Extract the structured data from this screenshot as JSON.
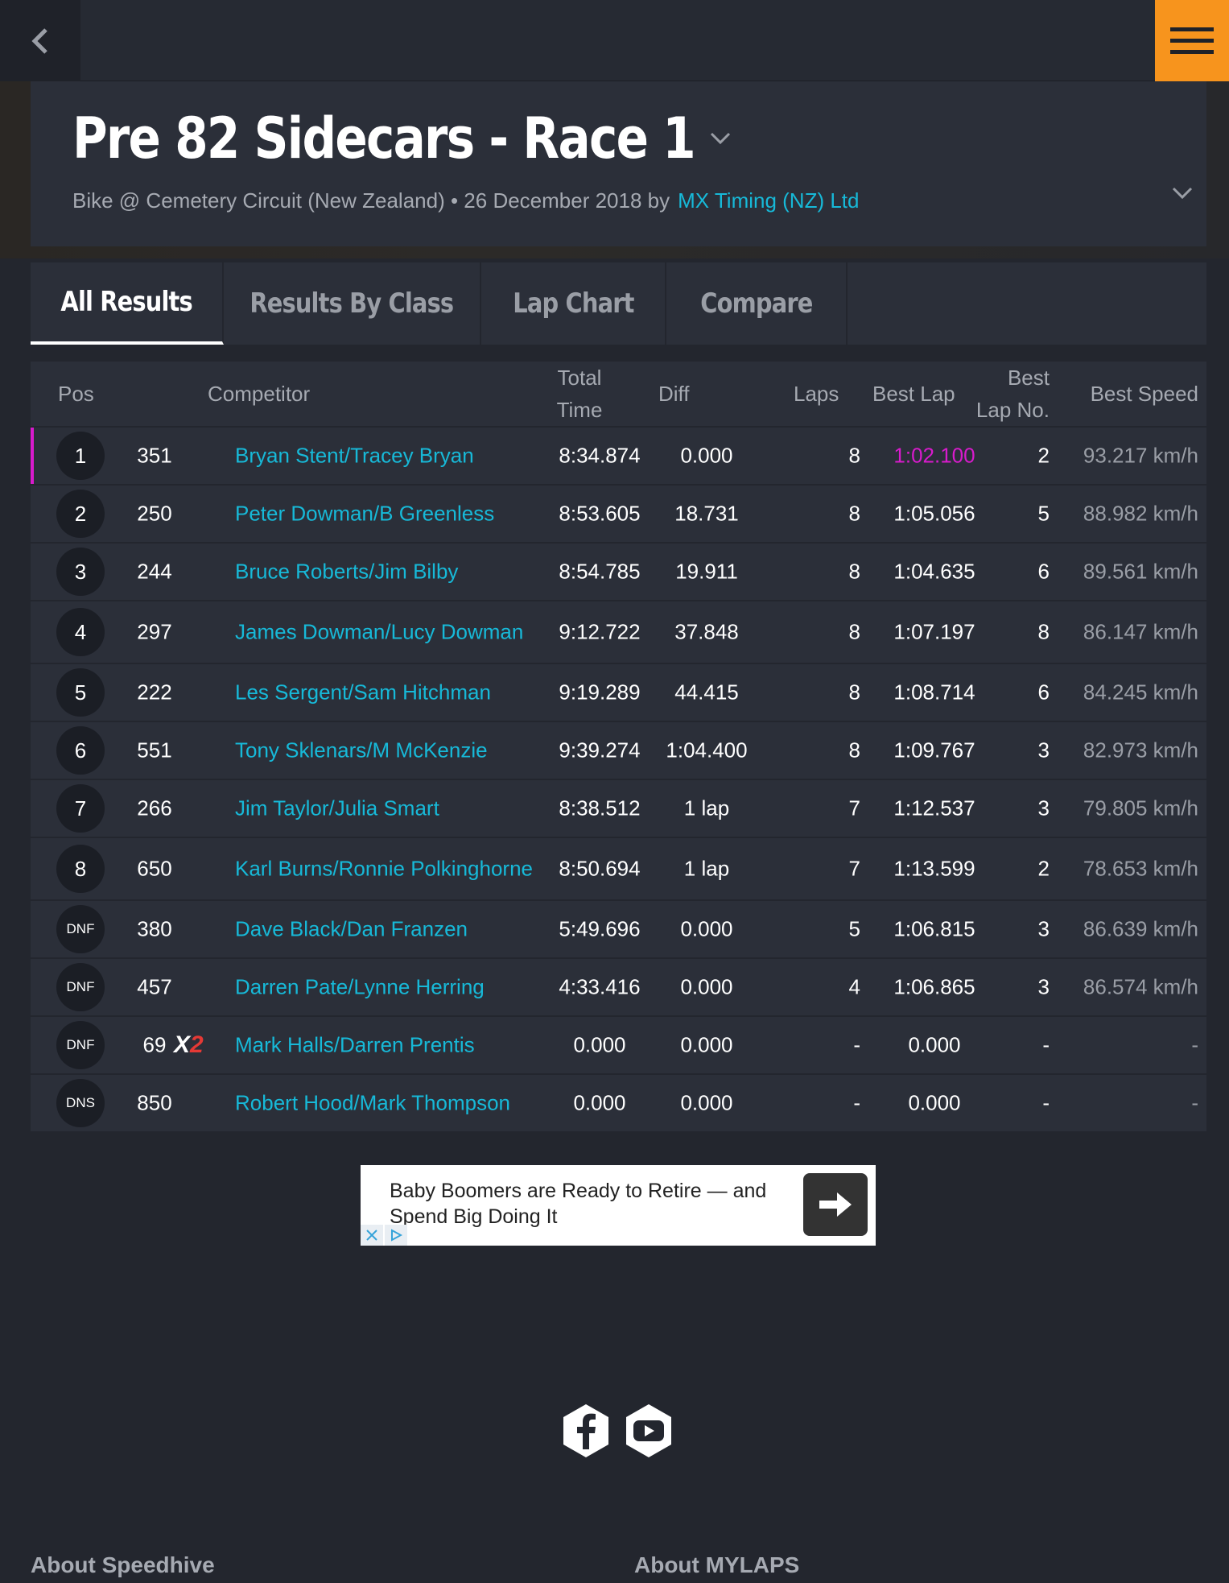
{
  "race": {
    "title": "Pre 82 Sidecars - Race 1",
    "subtitle": "Bike @ Cemetery Circuit (New Zealand) • 26 December 2018 by",
    "organizer": "MX Timing (NZ) Ltd"
  },
  "tabs": [
    {
      "label": "All Results"
    },
    {
      "label": "Results By Class"
    },
    {
      "label": "Lap Chart"
    },
    {
      "label": "Compare"
    }
  ],
  "columns": {
    "pos": "Pos",
    "competitor": "Competitor",
    "total_time_1": "Total",
    "total_time_2": "Time",
    "diff": "Diff",
    "laps": "Laps",
    "best_lap": "Best Lap",
    "best_lap_no_1": "Best",
    "best_lap_no_2": "Lap No.",
    "best_speed": "Best Speed"
  },
  "results": [
    {
      "pos": "1",
      "number": "351",
      "competitor": "Bryan Stent/Tracey Bryan",
      "total_time": "8:34.874",
      "diff": "0.000",
      "laps": "8",
      "best_lap": "1:02.100",
      "best_lap_no": "2",
      "best_speed": "93.217 km/h"
    },
    {
      "pos": "2",
      "number": "250",
      "competitor": "Peter Dowman/B Greenless",
      "total_time": "8:53.605",
      "diff": "18.731",
      "laps": "8",
      "best_lap": "1:05.056",
      "best_lap_no": "5",
      "best_speed": "88.982 km/h"
    },
    {
      "pos": "3",
      "number": "244",
      "competitor": "Bruce Roberts/Jim Bilby",
      "total_time": "8:54.785",
      "diff": "19.911",
      "laps": "8",
      "best_lap": "1:04.635",
      "best_lap_no": "6",
      "best_speed": "89.561 km/h"
    },
    {
      "pos": "4",
      "number": "297",
      "competitor": "James Dowman/Lucy Dowman",
      "total_time": "9:12.722",
      "diff": "37.848",
      "laps": "8",
      "best_lap": "1:07.197",
      "best_lap_no": "8",
      "best_speed": "86.147 km/h"
    },
    {
      "pos": "5",
      "number": "222",
      "competitor": "Les Sergent/Sam Hitchman",
      "total_time": "9:19.289",
      "diff": "44.415",
      "laps": "8",
      "best_lap": "1:08.714",
      "best_lap_no": "6",
      "best_speed": "84.245 km/h"
    },
    {
      "pos": "6",
      "number": "551",
      "competitor": "Tony Sklenars/M McKenzie",
      "total_time": "9:39.274",
      "diff": "1:04.400",
      "laps": "8",
      "best_lap": "1:09.767",
      "best_lap_no": "3",
      "best_speed": "82.973 km/h"
    },
    {
      "pos": "7",
      "number": "266",
      "competitor": "Jim Taylor/Julia Smart",
      "total_time": "8:38.512",
      "diff": "1 lap",
      "laps": "7",
      "best_lap": "1:12.537",
      "best_lap_no": "3",
      "best_speed": "79.805 km/h"
    },
    {
      "pos": "8",
      "number": "650",
      "competitor": "Karl Burns/Ronnie Polkinghorne",
      "total_time": "8:50.694",
      "diff": "1 lap",
      "laps": "7",
      "best_lap": "1:13.599",
      "best_lap_no": "2",
      "best_speed": "78.653 km/h"
    },
    {
      "pos": "DNF",
      "number": "380",
      "competitor": "Dave Black/Dan Franzen",
      "total_time": "5:49.696",
      "diff": "0.000",
      "laps": "5",
      "best_lap": "1:06.815",
      "best_lap_no": "3",
      "best_speed": "86.639 km/h"
    },
    {
      "pos": "DNF",
      "number": "457",
      "competitor": "Darren Pate/Lynne Herring",
      "total_time": "4:33.416",
      "diff": "0.000",
      "laps": "4",
      "best_lap": "1:06.865",
      "best_lap_no": "3",
      "best_speed": "86.574 km/h"
    },
    {
      "pos": "DNF",
      "number": "69",
      "competitor": "Mark Halls/Darren Prentis",
      "total_time": "0.000",
      "diff": "0.000",
      "laps": "-",
      "best_lap": "0.000",
      "best_lap_no": "-",
      "best_speed": "-",
      "badge": "X",
      "badge_num": "2"
    },
    {
      "pos": "DNS",
      "number": "850",
      "competitor": "Robert Hood/Mark Thompson",
      "total_time": "0.000",
      "diff": "0.000",
      "laps": "-",
      "best_lap": "0.000",
      "best_lap_no": "-",
      "best_speed": "-"
    }
  ],
  "ad": {
    "text": "Baby Boomers are Ready to Retire — and Spend Big Doing It"
  },
  "social": {
    "icons": [
      "facebook-icon",
      "youtube-icon"
    ]
  },
  "footer": {
    "about_speedhive": "About Speedhive",
    "about_mylaps": "About MYLAPS"
  },
  "colors": {
    "accent_orange": "#f7941d",
    "link_cyan": "#17b9d8",
    "fastest_magenta": "#d81bcc"
  }
}
